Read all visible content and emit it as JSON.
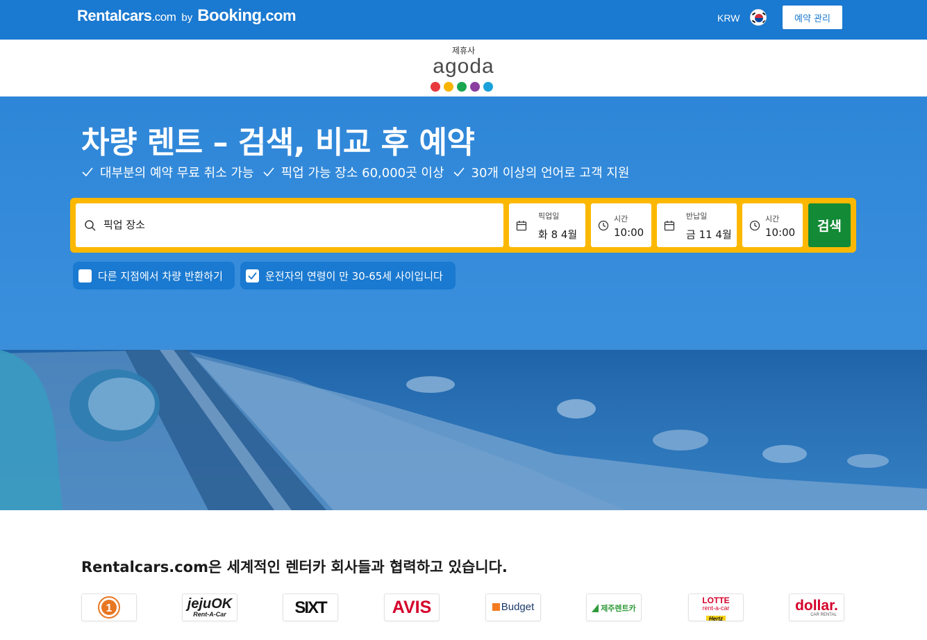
{
  "header": {
    "brand_name": "Rentalcars",
    "brand_suffix": ".com",
    "by": "by",
    "booking_name": "Booking",
    "booking_suffix": ".com",
    "currency": "KRW",
    "manage_label": "예약 관리"
  },
  "partner_band": {
    "label": "제휴사",
    "partner_name": "agoda",
    "dot_colors": [
      "#e8383d",
      "#f8b400",
      "#1aa650",
      "#8a3fa0",
      "#1aa1d9"
    ]
  },
  "hero": {
    "title": "차량 렌트 – 검색, 비교 후 예약",
    "perks": [
      "대부분의 예약 무료 취소 가능",
      "픽업 가능 장소 60,000곳 이상",
      "30개 이상의 언어로 고객 지원"
    ]
  },
  "search": {
    "location_placeholder": "픽업 장소",
    "pickup_date_label": "픽업일",
    "pickup_date_value": "화 8 4월",
    "pickup_time_label": "시간",
    "pickup_time_value": "10:00",
    "return_date_label": "반납일",
    "return_date_value": "금 11 4월",
    "return_time_label": "시간",
    "return_time_value": "10:00",
    "search_label": "검색"
  },
  "options": {
    "different_return_label": "다른 지점에서 차량 반환하기",
    "different_return_checked": false,
    "driver_age_label": "운전자의 연령이 만 30-65세 사이입니다",
    "driver_age_checked": true
  },
  "partners": {
    "title": "Rentalcars.com은 세계적인 렌터카 회사들과 협력하고 있습니다.",
    "logos": [
      {
        "name": "1",
        "color": "#e87722"
      },
      {
        "name": "jejuOK",
        "sub": "Rent-A-Car",
        "color": "#1a1a1a",
        "accent": "#e03a2f"
      },
      {
        "name": "SIXT",
        "color": "#111111"
      },
      {
        "name": "AVIS",
        "color": "#d4002a"
      },
      {
        "name": "Budget",
        "color": "#1a3a6b",
        "accent": "#f47b20"
      },
      {
        "name": "제주렌트카",
        "color": "#2f9a3a"
      },
      {
        "name": "LOTTE",
        "sub": "rent-a-car",
        "sub2": "Hertz",
        "color": "#d4002a"
      },
      {
        "name": "dollar.",
        "sub": "CAR RENTAL",
        "color": "#d4002a"
      }
    ]
  },
  "colors": {
    "brand_blue": "#1a79d0",
    "panel_yellow": "#fcb800",
    "search_green": "#138a36"
  }
}
